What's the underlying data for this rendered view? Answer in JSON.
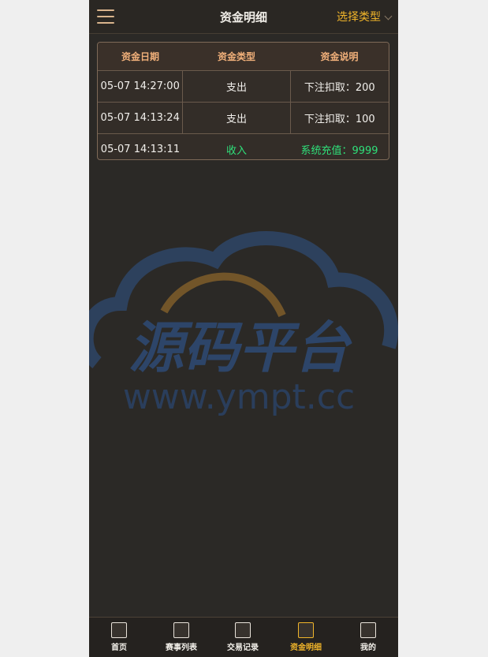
{
  "header": {
    "title": "资金明细",
    "type_select": "选择类型"
  },
  "table": {
    "columns": [
      "资金日期",
      "资金类型",
      "资金说明"
    ],
    "rows": [
      {
        "date": "05-07 14:27:00",
        "type": "支出",
        "desc": "下注扣取：200"
      },
      {
        "date": "05-07 14:13:24",
        "type": "支出",
        "desc": "下注扣取：100"
      },
      {
        "date": "05-07 14:13:11",
        "type": "收入",
        "desc": "系统充值：9999"
      }
    ]
  },
  "watermark": {
    "brand": "源码平台",
    "url": "www.ympt.cc"
  },
  "tabs": [
    {
      "label": "首页",
      "icon": "home-icon"
    },
    {
      "label": "赛事列表",
      "icon": "event-list-icon"
    },
    {
      "label": "交易记录",
      "icon": "trade-record-icon"
    },
    {
      "label": "资金明细",
      "icon": "funds-detail-icon",
      "active": true
    },
    {
      "label": "我的",
      "icon": "profile-icon"
    }
  ],
  "colors": {
    "accent": "#f1b52a",
    "income": "#2fe07a",
    "header_text": "#f1b07a"
  }
}
